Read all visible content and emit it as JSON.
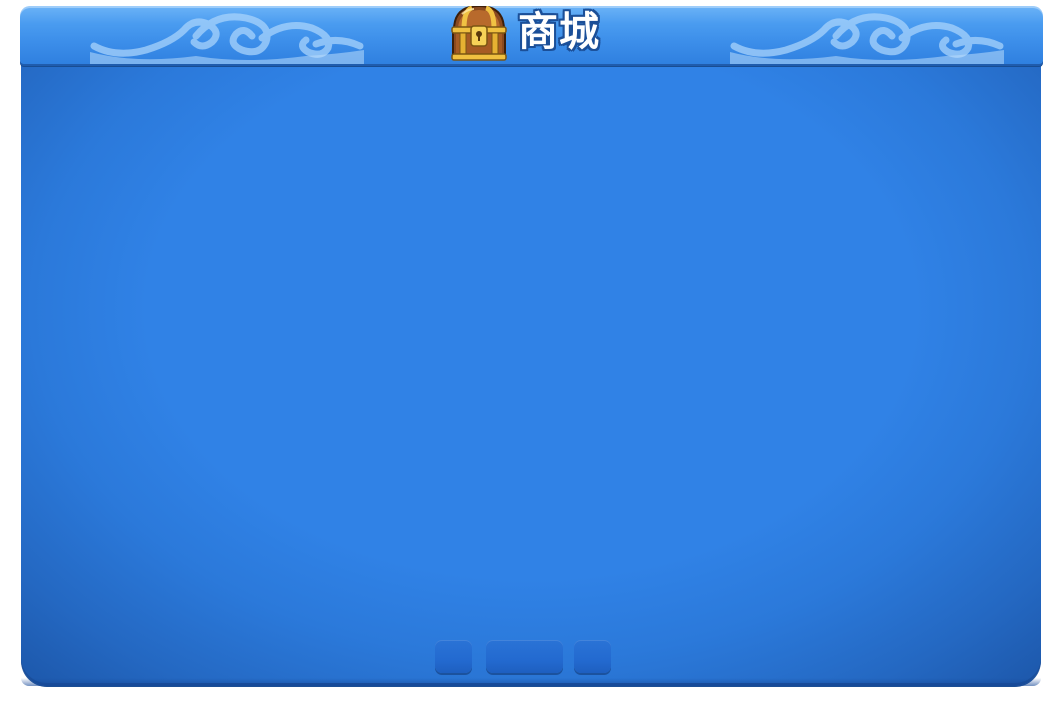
{
  "window": {
    "title": "商城",
    "title_icon": "treasure-chest-icon",
    "ornament_icon": "cloud-ornament-icon"
  },
  "pager": {
    "prev_icon": "page-prev-button",
    "indicator_icon": "page-indicator",
    "next_icon": "page-next-button"
  },
  "colors": {
    "title_bar": "#4a9cf0",
    "panel": "#3082e6",
    "panel_edge": "#1d58ab",
    "title_text": "#ffffff",
    "title_outline": "#1b4f98",
    "pager_button": "#236ad0",
    "chest_gold": "#e6b132",
    "chest_wood": "#8a4a1f"
  }
}
